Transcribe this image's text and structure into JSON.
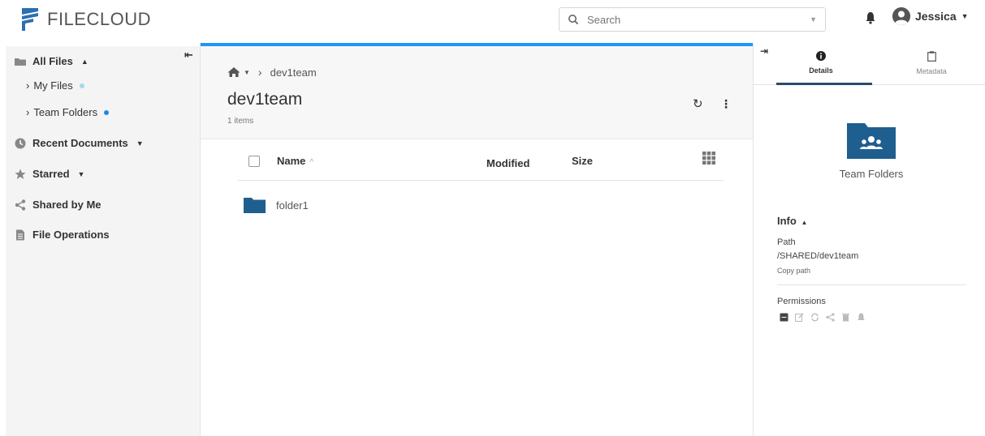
{
  "header": {
    "logo_text": "FILECLOUD",
    "search": {
      "placeholder": "Search",
      "value": ""
    },
    "user": {
      "name": "Jessica"
    }
  },
  "sidebar": {
    "collapse_icon": "collapse-left-icon",
    "items": [
      {
        "label": "All Files",
        "icon": "folder-icon"
      },
      {
        "label": "My Files",
        "dot_color": "#a8d8e8"
      },
      {
        "label": "Team Folders",
        "dot_color": "#1e88e5"
      },
      {
        "label": "Recent Documents",
        "icon": "clock-icon"
      },
      {
        "label": "Starred",
        "icon": "star-icon"
      },
      {
        "label": "Shared by Me",
        "icon": "share-icon"
      },
      {
        "label": "File Operations",
        "icon": "document-icon"
      }
    ]
  },
  "main": {
    "breadcrumb": {
      "home_icon": "home-icon",
      "current": "dev1team"
    },
    "title": "dev1team",
    "items_count": "1 items",
    "table": {
      "columns": [
        "Name",
        "Modified",
        "Size"
      ],
      "rows": [
        {
          "name": "folder1",
          "modified": "",
          "size": ""
        }
      ]
    },
    "accent_color": "#2196f3"
  },
  "right_panel": {
    "tabs": [
      {
        "label": "Details",
        "icon": "info-icon",
        "active": true
      },
      {
        "label": "Metadata",
        "icon": "clipboard-icon",
        "active": false
      }
    ],
    "folder_label": "Team Folders",
    "info": {
      "heading": "Info",
      "path_label": "Path",
      "path_value": "/SHARED/dev1team",
      "copy_path": "Copy path",
      "permissions_label": "Permissions"
    },
    "folder_color": "#1f5f8f"
  }
}
